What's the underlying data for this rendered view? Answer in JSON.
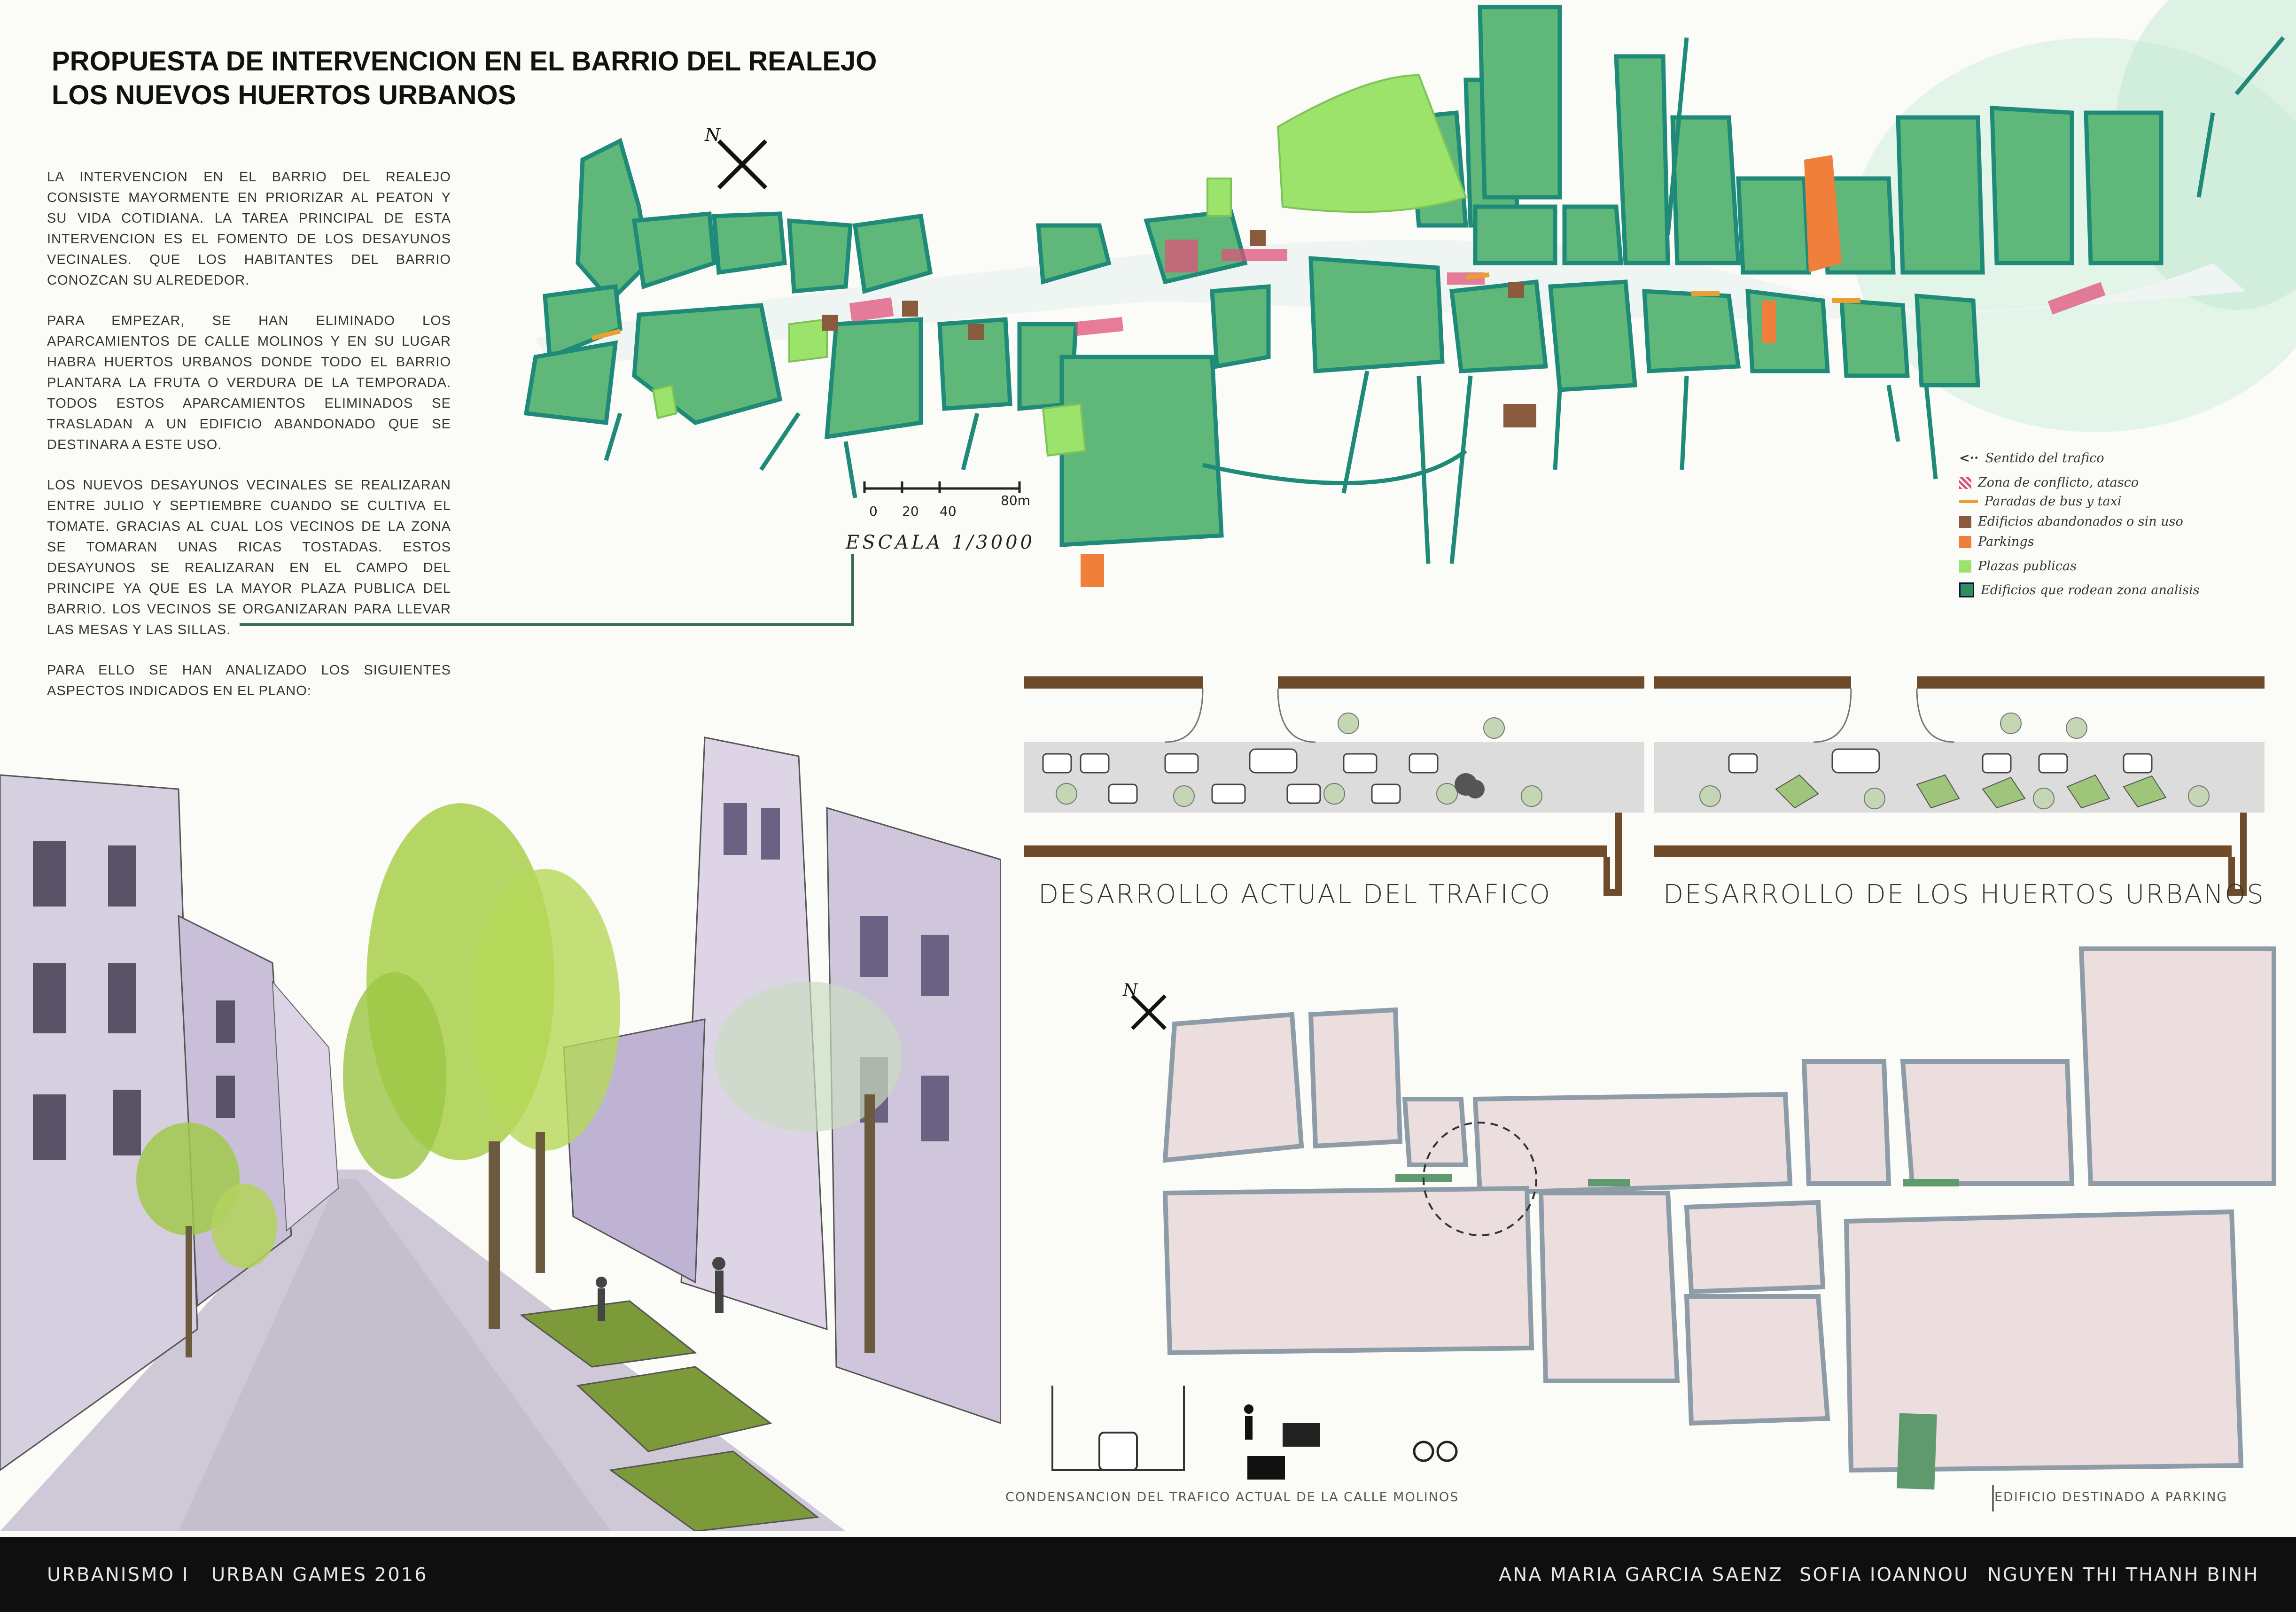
{
  "title": {
    "line1": "PROPUESTA DE INTERVENCION EN EL BARRIO DEL REALEJO",
    "line2": "LOS NUEVOS HUERTOS URBANOS"
  },
  "intro": {
    "p1": "La intervencion en el barrio del realejo consiste mayormente en priorizar al peaton y su vida cotidiana. La tarea principal de esta intervencion es el fomento de los desayunos vecinales. que los habitantes del barrio conozcan su alrededor.",
    "p2": "Para empezar, se han eliminado los aparcamientos de calle molinos y en su lugar habra huertos urbanos donde todo el barrio plantara la fruta o verdura de la temporada. Todos estos aparcamientos eliminados se trasladan a un edificio abandonado que se destinara a este uso.",
    "p3": "Los nuevos desayunos vecinales se realizaran entre julio y septiembre cuando se cultiva el tomate. Gracias al cual los vecinos de la zona se tomaran unas ricas tostadas. Estos desayunos se realizaran en el campo del principe ya que es la mayor plaza publica del barrio. Los vecinos se organizaran para llevar las mesas y las sillas.",
    "p4": "Para ello se han analizado los siguientes aspectos indicados en el plano:"
  },
  "scale": {
    "ticks": [
      "0",
      "20",
      "40",
      "80m"
    ],
    "label": "ESCALA 1/3000"
  },
  "north": "N",
  "legend": [
    {
      "label": "Sentido del trafico",
      "color": "#333333",
      "kind": "arrow"
    },
    {
      "label": "Zona de conflicto, atasco",
      "color": "#e0527a",
      "kind": "hatch"
    },
    {
      "label": "Paradas de bus y taxi",
      "color": "#e8a030",
      "kind": "line"
    },
    {
      "label": "Edificios abandonados o sin uso",
      "color": "#8a5a3c",
      "kind": "box"
    },
    {
      "label": "Parkings",
      "color": "#ef7f3a",
      "kind": "box"
    },
    {
      "label": "Plazas publicas",
      "color": "#9be36a",
      "kind": "box"
    },
    {
      "label": "Edificios que rodean zona analisis",
      "color": "#2f8f5a",
      "kind": "box"
    }
  ],
  "sections": {
    "current": "DESARROLLO ACTUAL DEL TRAFICO",
    "gardens": "DESARROLLO DE LOS HUERTOS URBANOS"
  },
  "captions": {
    "traffic": "CONDENSANCION DEL TRAFICO ACTUAL DE LA CALLE MOLINOS",
    "parking": "EDIFICIO DESTINADO A PARKING"
  },
  "footer": {
    "course": "URBANISMO I",
    "event": "URBAN GAMES 2016",
    "author1": "ANA MARIA GARCIA SAENZ",
    "author2": "SOFIA IOANNOU",
    "author3": "NGUYEN THI THANH BINH"
  },
  "colors": {
    "block_green": "#3f9a62",
    "block_fill": "#5fb77a",
    "plaza": "#9be36a",
    "parking": "#ef7f3a",
    "abandoned": "#8a5a3c",
    "conflict": "#e0527a",
    "street_outline": "#1f8a78",
    "pink_block": "#ecdede"
  }
}
